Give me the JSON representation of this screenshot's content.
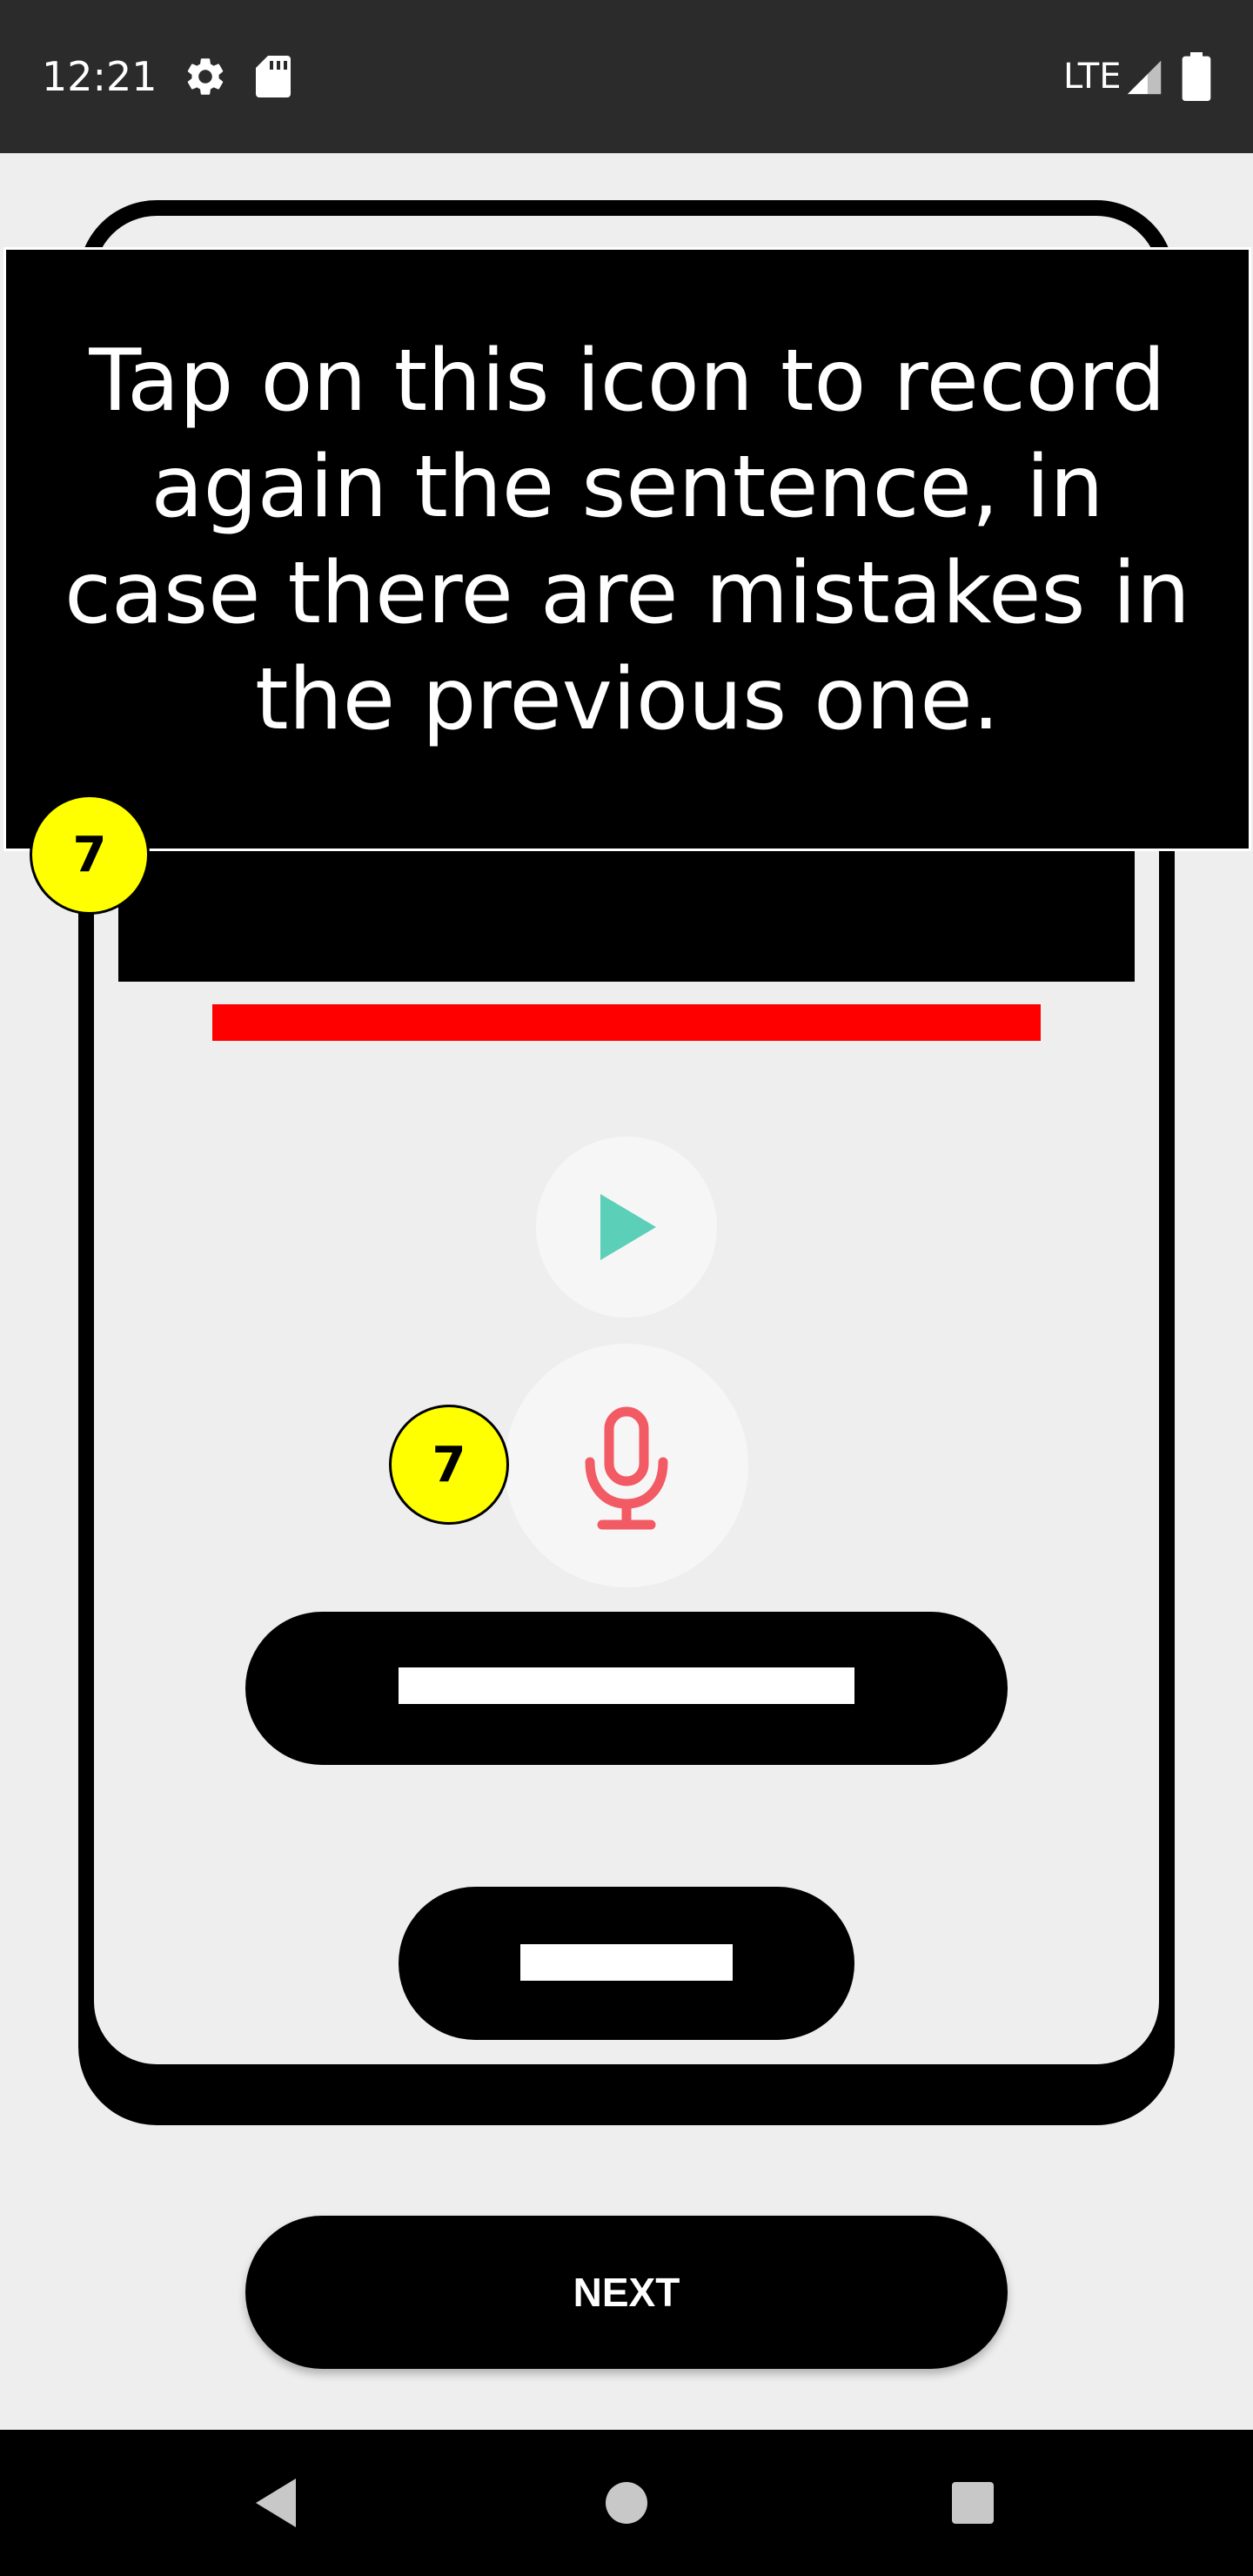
{
  "status_bar": {
    "time": "12:21",
    "network": "LTE",
    "icons": [
      "settings-icon",
      "sd-card-icon",
      "signal-icon",
      "battery-icon"
    ]
  },
  "tooltip": {
    "text": "Tap on this icon to record again the sentence, in case there are mistakes in the previous one."
  },
  "badges": {
    "tooltip_step": "7",
    "mic_step": "7"
  },
  "controls": {
    "play_icon": "play-icon",
    "mic_icon": "microphone-icon"
  },
  "footer": {
    "next_label": "NEXT"
  },
  "nav_bar": {
    "icons": [
      "back-icon",
      "home-icon",
      "recents-icon"
    ]
  },
  "colors": {
    "status_bar": "#2b2b2b",
    "background": "#eeeeee",
    "progress_red": "#ff0000",
    "play_teal": "#5ccfb8",
    "mic_red": "#f25a64",
    "badge_yellow": "#ffff00"
  }
}
